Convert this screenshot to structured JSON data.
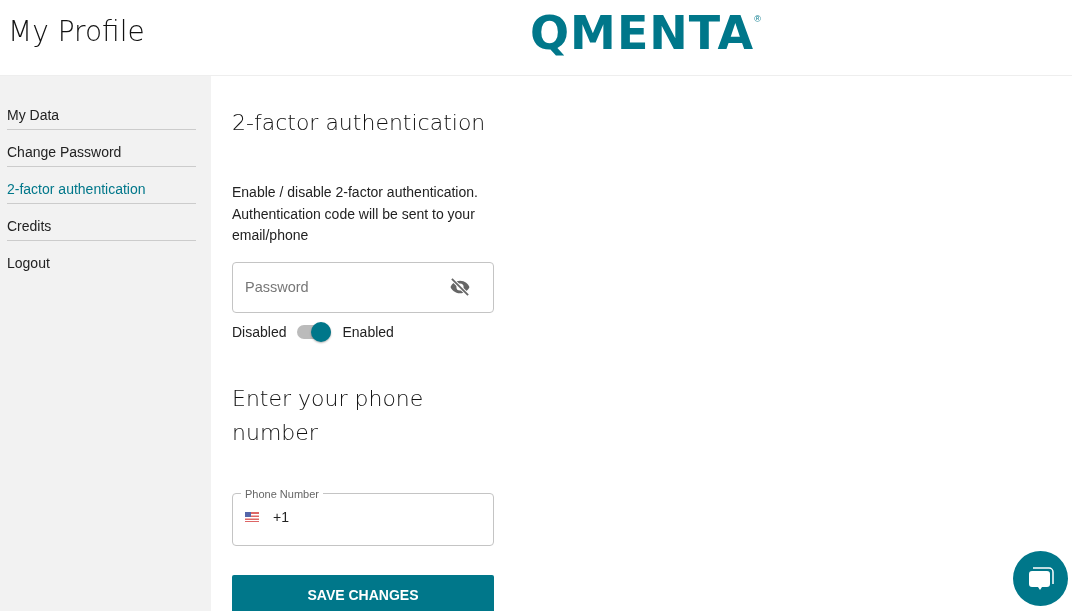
{
  "header": {
    "title": "My Profile",
    "logo": "QMENTA",
    "logo_mark": "®"
  },
  "sidebar": {
    "items": [
      {
        "label": "My Data",
        "selected": false
      },
      {
        "label": "Change Password",
        "selected": false
      },
      {
        "label": "2-factor authentication",
        "selected": true
      },
      {
        "label": "Credits",
        "selected": false
      },
      {
        "label": "Logout",
        "selected": false
      }
    ]
  },
  "twofa": {
    "heading": "2-factor authentication",
    "description": "Enable / disable 2-factor authentication. Authentication code will be sent to your email/phone",
    "password": {
      "placeholder": "Password"
    },
    "toggle": {
      "off_label": "Disabled",
      "on_label": "Enabled",
      "on": true
    }
  },
  "phone": {
    "heading": "Enter your phone number",
    "field": {
      "label": "Phone Number",
      "value": "+1"
    }
  },
  "save_button": "SAVE CHANGES"
}
